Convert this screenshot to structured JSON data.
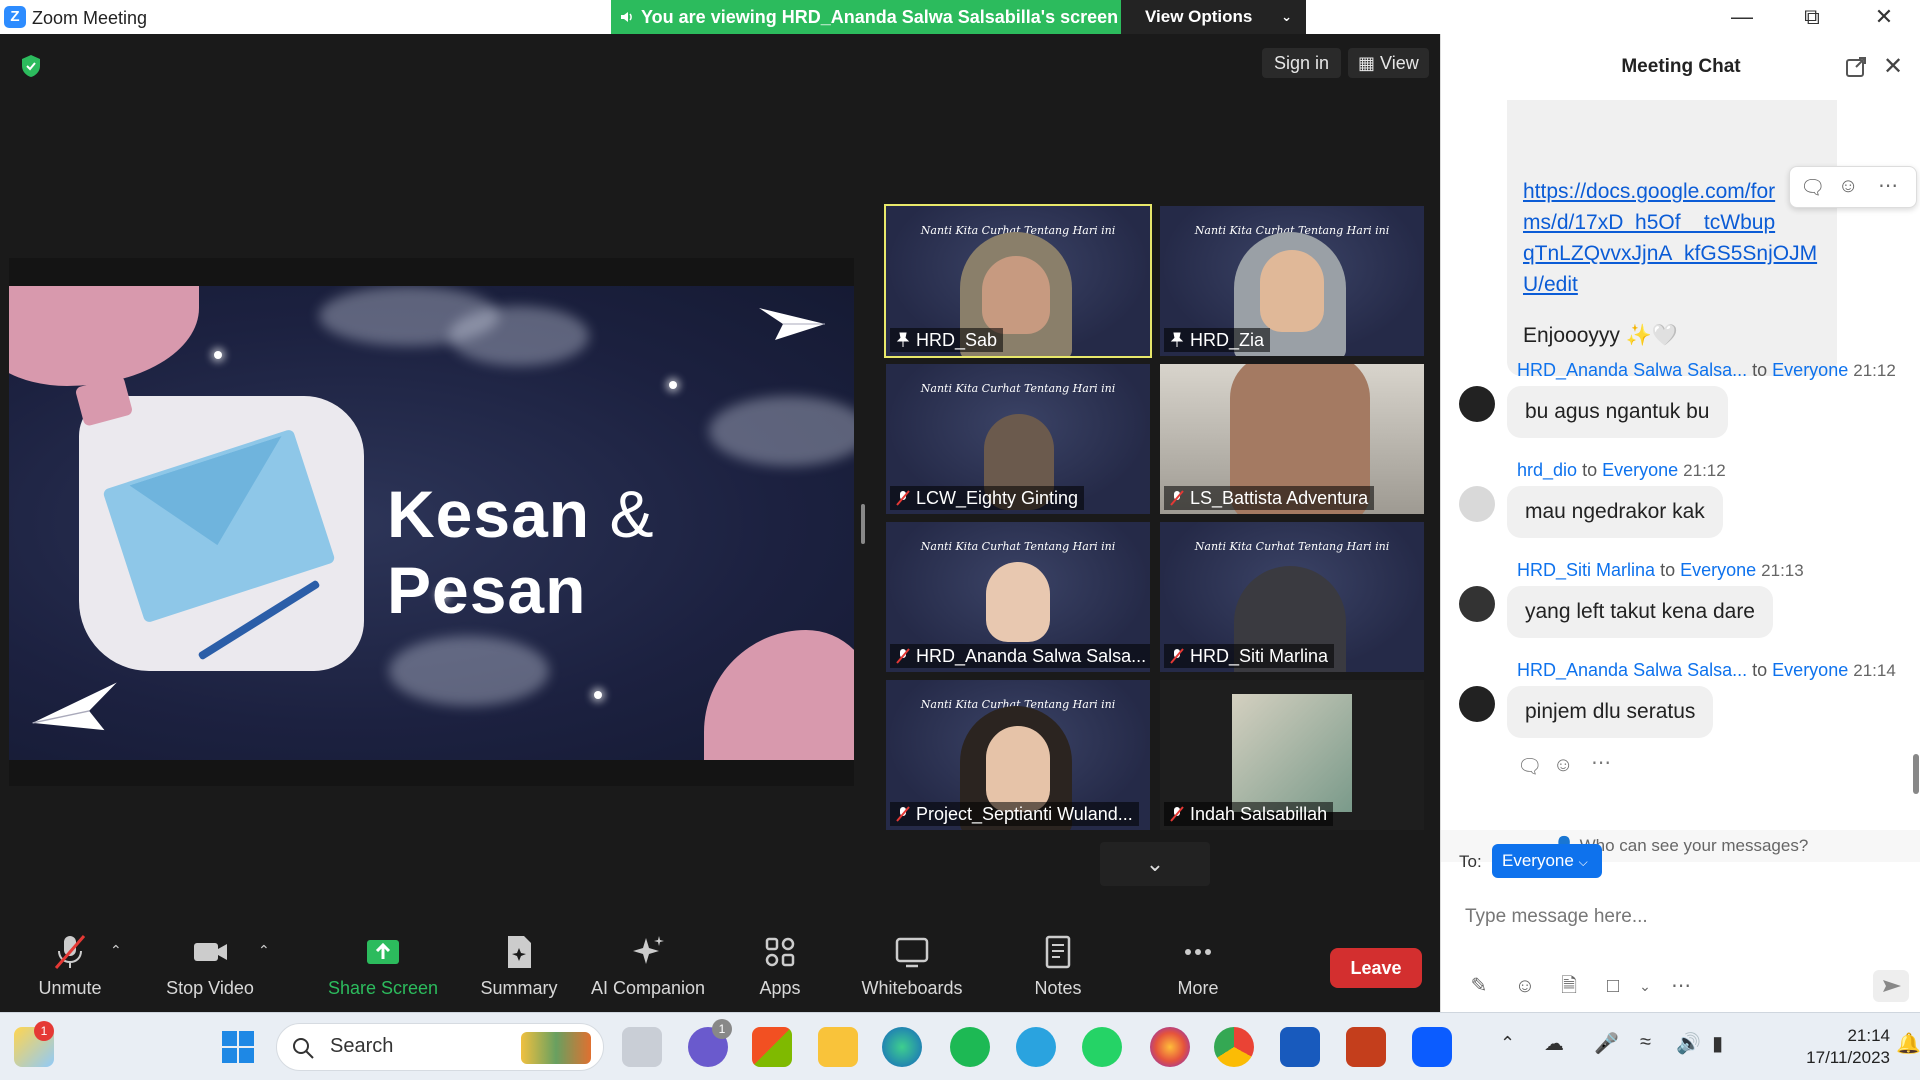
{
  "window": {
    "app_title": "Zoom Meeting",
    "viewing_banner": "You are viewing HRD_Ananda Salwa Salsabilla's screen",
    "view_options": "View Options"
  },
  "meeting_top": {
    "signin": "Sign in",
    "view": "View"
  },
  "slide": {
    "title_part1": "Kesan",
    "title_amp": "&",
    "title_part2": "Pesan"
  },
  "tile_banner": "Nanti Kita Curhat Tentang Hari ini",
  "participants": [
    {
      "name": "HRD_Sab"
    },
    {
      "name": "HRD_Zia"
    },
    {
      "name": "LCW_Eighty Ginting"
    },
    {
      "name": "LS_Battista Adventura"
    },
    {
      "name": "HRD_Ananda Salwa Salsa..."
    },
    {
      "name": "HRD_Siti Marlina"
    },
    {
      "name": "Project_Septianti Wuland..."
    },
    {
      "name": "Indah Salsabillah"
    }
  ],
  "toolbar": {
    "unmute": "Unmute",
    "stop_video": "Stop Video",
    "share_screen": "Share Screen",
    "summary": "Summary",
    "ai_companion": "AI Companion",
    "apps": "Apps",
    "whiteboards": "Whiteboards",
    "notes": "Notes",
    "more": "More",
    "leave": "Leave"
  },
  "chat": {
    "title": "Meeting Chat",
    "first_bubble": {
      "link_lines": [
        "https://docs.google.com/for",
        "ms/d/17xD_h5Of__tcWbup",
        "qTnLZQvvxJjnA_kfGS5SnjOJM",
        "U/edit"
      ],
      "text": "Enjoooyyy ✨🤍"
    },
    "messages": [
      {
        "sender": "HRD_Ananda Salwa Salsa...",
        "to_label": "to",
        "recipient": "Everyone",
        "time": "21:12",
        "text": "bu agus ngantuk bu"
      },
      {
        "sender": "hrd_dio",
        "to_label": "to",
        "recipient": "Everyone",
        "time": "21:12",
        "text": "mau ngedrakor kak"
      },
      {
        "sender": "HRD_Siti Marlina",
        "to_label": "to",
        "recipient": "Everyone",
        "time": "21:13",
        "text": "yang left takut kena dare"
      },
      {
        "sender": "HRD_Ananda Salwa Salsa...",
        "to_label": "to",
        "recipient": "Everyone",
        "time": "21:14",
        "text": "pinjem dlu seratus"
      }
    ],
    "who_can_see": "Who can see your messages?",
    "to_label": "To:",
    "to_value": "Everyone",
    "input_placeholder": "Type message here..."
  },
  "taskbar": {
    "search": "Search",
    "time": "21:14",
    "date": "17/11/2023",
    "weather_badge": "1",
    "chat_badge": "1"
  }
}
